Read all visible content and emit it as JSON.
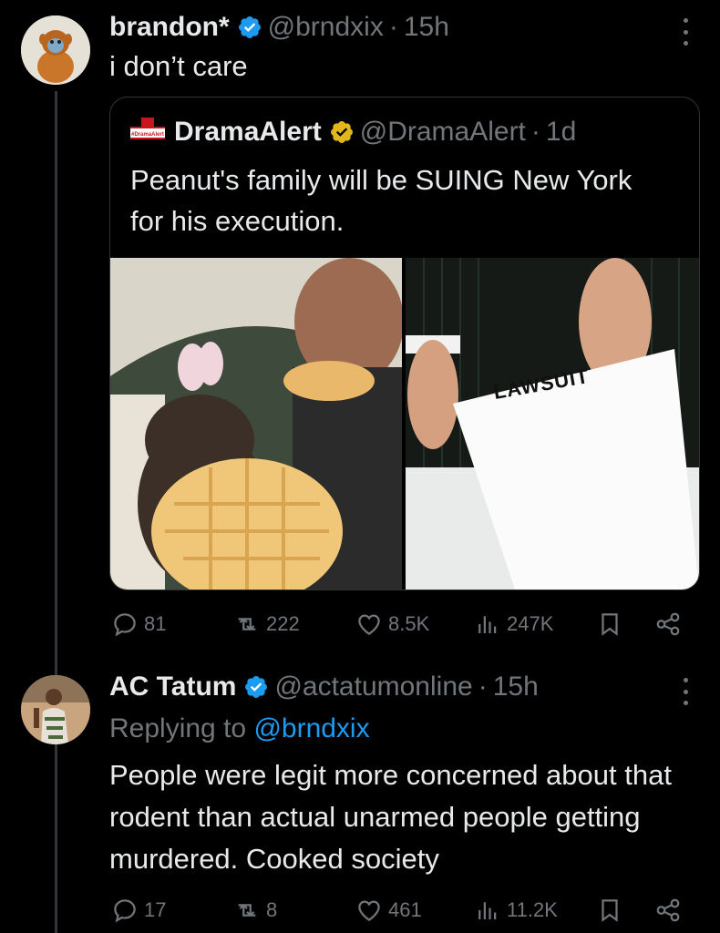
{
  "tweet1": {
    "display_name": "brandon*",
    "handle": "@brndxix",
    "separator": "·",
    "time": "15h",
    "text": "i don’t care",
    "quote": {
      "display_name": "DramaAlert",
      "handle": "@DramaAlert",
      "separator": "·",
      "time": "1d",
      "text": "Peanut's family will be SUING New York for his execution.",
      "logo_text": "#DramaAlert",
      "lawsuit_label": "LAWSUIT"
    },
    "stats": {
      "replies": "81",
      "reposts": "222",
      "likes": "8.5K",
      "views": "247K"
    }
  },
  "tweet2": {
    "display_name": "AC Tatum",
    "handle": "@actatumonline",
    "separator": "·",
    "time": "15h",
    "replying_prefix": "Replying to",
    "replying_handle": "@brndxix",
    "text": "People were legit more concerned about that rodent than actual unarmed people getting murdered. Cooked society",
    "stats": {
      "replies": "17",
      "reposts": "8",
      "likes": "461",
      "views": "11.2K"
    }
  },
  "icons": [
    "verified-blue-icon",
    "verified-gold-icon",
    "more-icon",
    "reply-icon",
    "repost-icon",
    "like-icon",
    "views-icon",
    "bookmark-icon",
    "share-icon"
  ],
  "colors": {
    "background": "#000000",
    "text": "#e7e9ea",
    "muted": "#71767b",
    "link": "#1d9bf0",
    "verified_blue": "#1d9bf0",
    "verified_gold": "#e2b719"
  }
}
